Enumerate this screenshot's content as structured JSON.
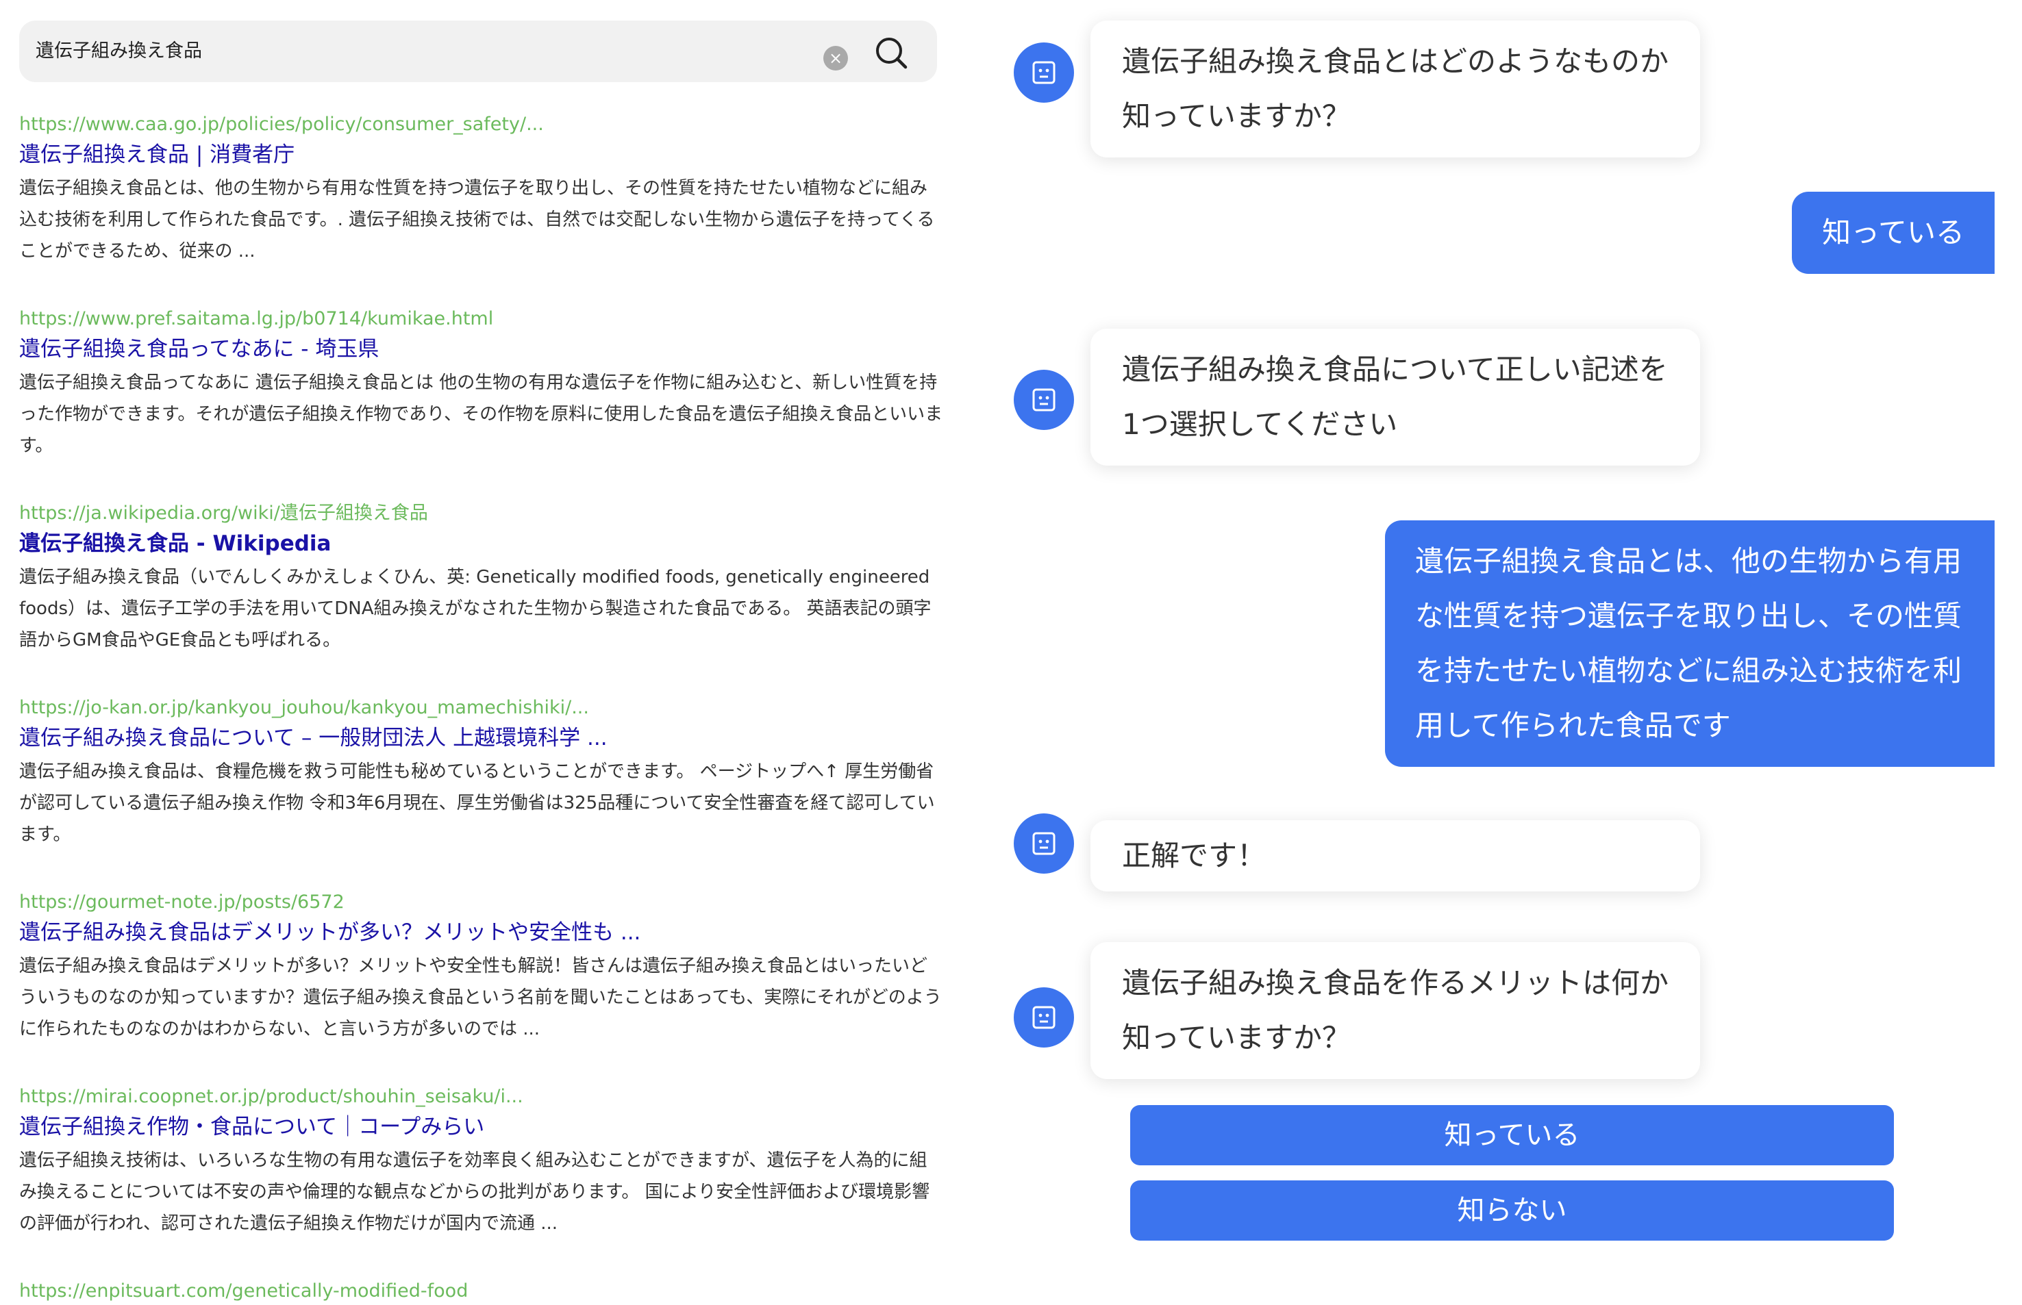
{
  "search": {
    "query": "遺伝子組み換え食品",
    "clear_icon": "×",
    "results": [
      {
        "url": "https://www.caa.go.jp/policies/policy/consumer_safety/...",
        "title": "遺伝子組換え食品 | 消費者庁",
        "snippet": "遺伝子組換え食品とは、他の生物から有用な性質を持つ遺伝子を取り出し、その性質を持たせたい植物などに組み込む技術を利用して作られた食品です。. 遺伝子組換え技術では、自然では交配しない生物から遺伝子を持ってくることができるため、従来の ..."
      },
      {
        "url": "https://www.pref.saitama.lg.jp/b0714/kumikae.html",
        "title": "遺伝子組換え食品ってなあに - 埼玉県",
        "snippet": "遺伝子組換え食品ってなあに 遺伝子組換え食品とは 他の生物の有用な遺伝子を作物に組み込むと、新しい性質を持った作物ができます。それが遺伝子組換え作物であり、その作物を原料に使用した食品を遺伝子組換え食品といいます。"
      },
      {
        "url": "https://ja.wikipedia.org/wiki/遺伝子組換え食品",
        "title": "遺伝子組換え食品 - Wikipedia",
        "snippet": "遺伝子組み換え食品（いでんしくみかえしょくひん、英: Genetically modified foods, genetically engineered foods）は、遺伝子工学の手法を用いてDNA組み換えがなされた生物から製造された食品である。 英語表記の頭字語からGM食品やGE食品とも呼ばれる。"
      },
      {
        "url": "https://jo-kan.or.jp/kankyou_jouhou/kankyou_mamechishiki/...",
        "title": "遺伝子組み換え食品について – 一般財団法人 上越環境科学 ...",
        "snippet": "遺伝子組み換え食品は、食糧危機を救う可能性も秘めているということができます。 ページトップへ↑ 厚生労働省が認可している遺伝子組み換え作物 令和3年6月現在、厚生労働省は325品種について安全性審査を経て認可しています。"
      },
      {
        "url": "https://gourmet-note.jp/posts/6572",
        "title": "遺伝子組み換え食品はデメリットが多い？メリットや安全性も ...",
        "snippet": "遺伝子組み換え食品はデメリットが多い？メリットや安全性も解説！皆さんは遺伝子組み換え食品とはいったいどういうものなのか知っていますか？遺伝子組み換え食品という名前を聞いたことはあっても、実際にそれがどのように作られたものなのかはわからない、と言いう方が多いのでは ..."
      },
      {
        "url": "https://mirai.coopnet.or.jp/product/shouhin_seisaku/i...",
        "title": "遺伝子組換え作物・食品について｜コープみらい",
        "snippet": "遺伝子組換え技術は、いろいろな生物の有用な遺伝子を効率良く組み込むことができますが、遺伝子を人為的に組み換えることについては不安の声や倫理的な観点などからの批判があります。 国により安全性評価および環境影響の評価が行われ、認可された遺伝子組換え作物だけが国内で流通 ..."
      },
      {
        "url": "https://enpitsuart.com/genetically-modified-food",
        "title": "",
        "snippet": ""
      }
    ]
  },
  "chat": {
    "messages": [
      {
        "role": "bot",
        "text": "遺伝子組み換え食品とはどのようなものか知っていますか？"
      },
      {
        "role": "user",
        "text": "知っている"
      },
      {
        "role": "bot",
        "text": "遺伝子組み換え食品について正しい記述を1つ選択してください"
      },
      {
        "role": "user",
        "text": "遺伝子組換え食品とは、他の生物から有用な性質を持つ遺伝子を取り出し、その性質を持たせたい植物などに組み込む技術を利用して作られた食品です"
      },
      {
        "role": "bot",
        "text": "正解です！"
      },
      {
        "role": "bot",
        "text": "遺伝子組み換え食品を作るメリットは何か知っていますか？"
      }
    ],
    "choices": [
      "知っている",
      "知らない"
    ]
  },
  "colors": {
    "accent": "#3c74ee",
    "url_green": "#6bba5c",
    "link_blue": "#1a12a6"
  },
  "icons": {
    "search_button": "search-icon",
    "clear_button": "clear-icon",
    "bot_avatar": "robot-face-icon"
  }
}
